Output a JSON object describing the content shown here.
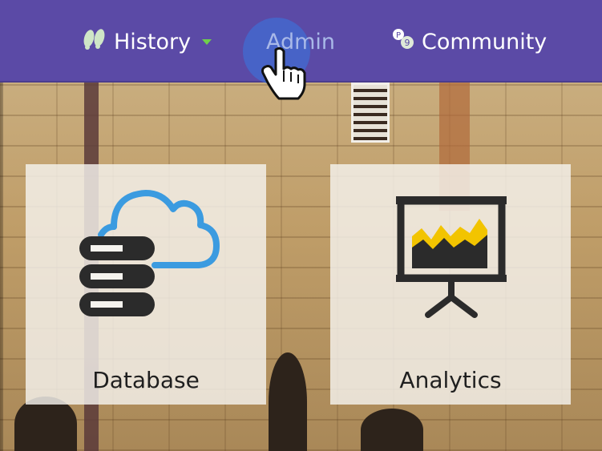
{
  "nav": {
    "items": [
      {
        "label": "History",
        "icon": "footprints-icon",
        "has_dropdown": true
      },
      {
        "label": "Admin",
        "icon": null,
        "state": "hover"
      },
      {
        "label": "Community",
        "icon": "people-tags-icon"
      }
    ]
  },
  "cards": [
    {
      "label": "Database",
      "icon": "database-cloud-icon"
    },
    {
      "label": "Analytics",
      "icon": "presentation-chart-icon"
    }
  ],
  "colors": {
    "navbar": "#5b4aa6",
    "caret": "#6fd04b",
    "admin_text": "#a9b9e8",
    "cloud": "#3b9be0",
    "chart_yellow": "#f2c400",
    "icon_dark": "#2b2b2b"
  }
}
